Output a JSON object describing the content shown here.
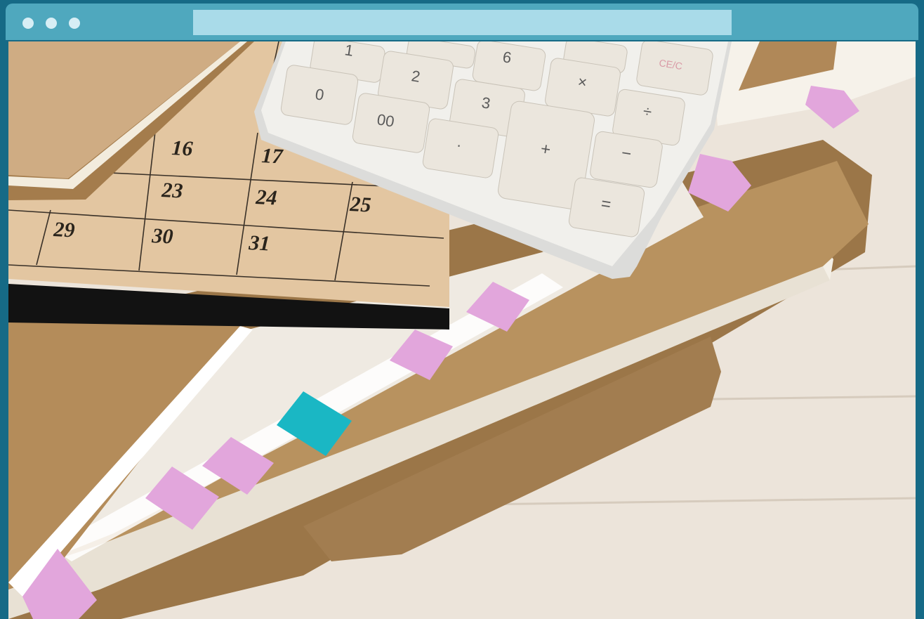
{
  "browser": {
    "url": ""
  },
  "calendar": {
    "dates": [
      "16",
      "17",
      "23",
      "24",
      "25",
      "29",
      "30",
      "31"
    ]
  },
  "calculator": {
    "keys": [
      "1",
      "6",
      "CE/C",
      "0",
      "2",
      "×",
      "3",
      "÷",
      "00",
      "·",
      "+",
      "−",
      "="
    ]
  },
  "colors": {
    "frame": "#166a86",
    "titlebar": "#4fa8be",
    "urlbar": "#a9dbe9",
    "kraft": "#b8925f",
    "sticky_pink": "#e2a6dc",
    "sticky_teal": "#1ab7c4"
  }
}
